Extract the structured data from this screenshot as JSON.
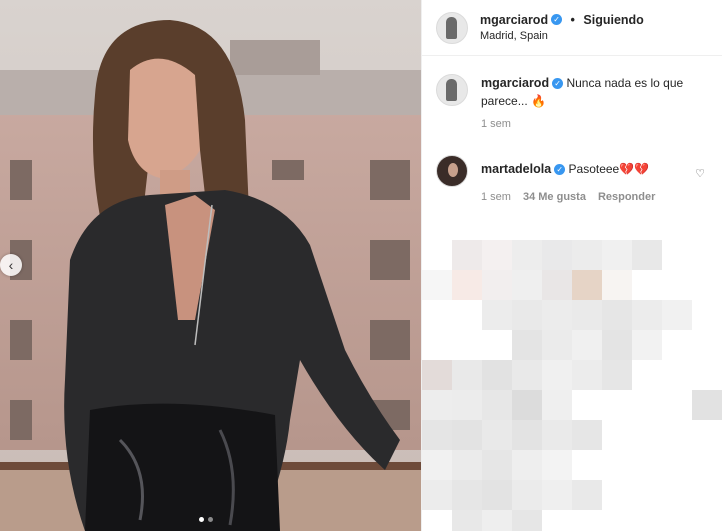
{
  "post": {
    "username": "mgarciarod",
    "follow_status": "Siguiendo",
    "location": "Madrid, Spain"
  },
  "caption": {
    "username": "mgarciarod",
    "text": "Nunca nada es lo que parece...",
    "emoji": "🔥",
    "time": "1 sem"
  },
  "comments": [
    {
      "username": "martadelola",
      "text": "Pasoteee",
      "emoji": "💔💔",
      "time": "1 sem",
      "likes": "34 Me gusta",
      "reply": "Responder"
    }
  ],
  "carousel": {
    "prev_icon": "‹",
    "dot_count": 2,
    "active_dot": 0
  },
  "icons": {
    "verified": "✓",
    "heart": "♡"
  },
  "colors": {
    "verified": "#3897f0",
    "meta_text": "#8e8e8e"
  }
}
